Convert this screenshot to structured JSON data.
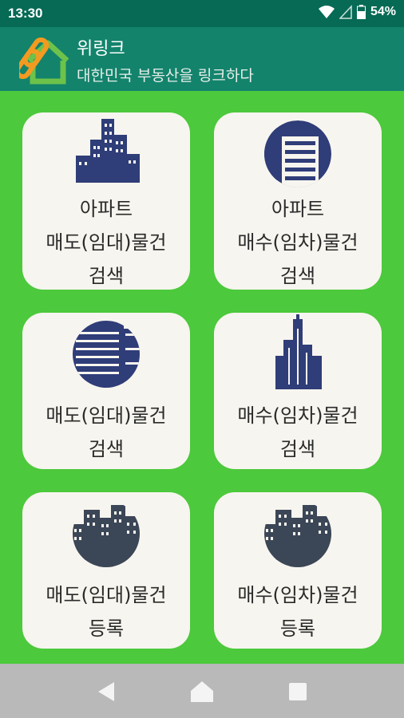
{
  "status": {
    "time": "13:30",
    "battery": "54%"
  },
  "app": {
    "title": "위링크",
    "subtitle": "대한민국 부동산을 링크하다"
  },
  "cards": [
    {
      "line1": "아파트",
      "line2": "매도(임대)물건",
      "line3": "검색",
      "icon": "apartment-towers-icon"
    },
    {
      "line1": "아파트",
      "line2": "매수(임차)물건",
      "line3": "검색",
      "icon": "apartment-building-icon"
    },
    {
      "line1": "매도(임대)물건",
      "line2": "검색",
      "icon": "office-building-icon"
    },
    {
      "line1": "매수(임차)물건",
      "line2": "검색",
      "icon": "skyscraper-icon"
    },
    {
      "line1": "매도(임대)물건",
      "line2": "등록",
      "icon": "city-buildings-icon"
    },
    {
      "line1": "매수(임차)물건",
      "line2": "등록",
      "icon": "city-buildings-icon"
    }
  ],
  "colors": {
    "status": "#066a55",
    "appbar": "#13836c",
    "background": "#4cc93c",
    "card": "#f7f5ef",
    "icon": "#2f3d78"
  },
  "nav": {
    "back": "back-icon",
    "home": "home-icon",
    "recents": "recents-icon"
  }
}
